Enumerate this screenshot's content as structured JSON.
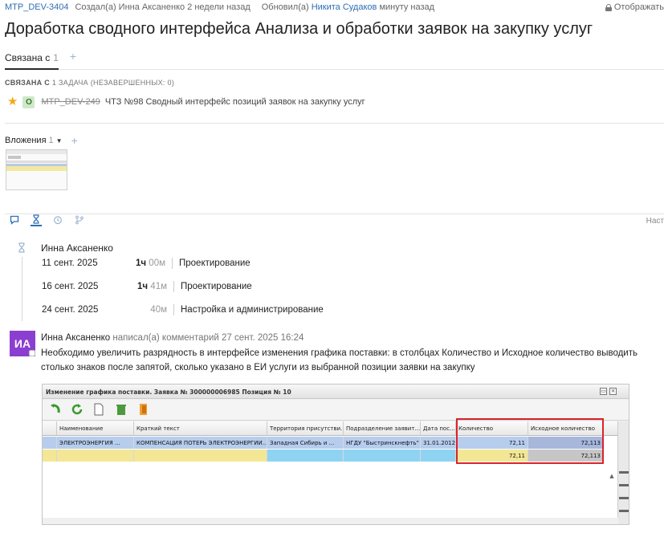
{
  "meta": {
    "issue_key": "MTP_DEV-3404",
    "created": "Создал(а) Инна Аксаненко 2 недели назад",
    "updated_prefix": "Обновил(а)",
    "updated_user": "Никита Судаков",
    "updated_suffix": "минуту назад",
    "right_label": "Отображать"
  },
  "title": "Доработка сводного интерфейса Анализа и обработки заявок на закупку услуг",
  "tabs": [
    {
      "label": "Связана с",
      "count": "1"
    }
  ],
  "linked": {
    "caption": "СВЯЗАНА С",
    "caption_rest": "1 ЗАДАЧА (НЕЗАВЕРШЕННЫХ: 0)",
    "issue": {
      "status": "О",
      "key": "MTP_DEV-249",
      "summary": "ЧТЗ №98 Сводный интерфейс позиций заявок на закупку услуг"
    }
  },
  "attachments": {
    "label": "Вложения",
    "count": "1"
  },
  "activity": {
    "right_label": "Наст"
  },
  "worklog": {
    "user": "Инна Аксаненко",
    "entries": [
      {
        "date": "11 сент. 2025",
        "hours": "1ч",
        "minutes": "00м",
        "activity": "Проектирование"
      },
      {
        "date": "16 сент. 2025",
        "hours": "1ч",
        "minutes": "41м",
        "activity": "Проектирование"
      },
      {
        "date": "24 сент. 2025",
        "hours": "",
        "minutes": "40м",
        "activity": "Настройка и администрирование"
      }
    ]
  },
  "comment": {
    "avatar": "ИА",
    "author": "Инна Аксаненко",
    "action": "написал(а) комментарий 27 сент. 2025 16:24",
    "text": "Необходимо увеличить разрядность в интерфейсе изменения графика поставки: в столбцах Количество и Исходное количество выводить столько знаков после запятой, сколько указано в ЕИ услуги из выбранной позиции заявки на закупку"
  },
  "embedded": {
    "title": "Изменение графика поставки. Заявка № 300000006985 Позиция № 10",
    "headers": [
      "Наименование",
      "Краткий текст",
      "Территория присутстви...",
      "Подразделение заявит...",
      "Дата пос...",
      "Количество",
      "Исходное количество"
    ],
    "row1": [
      "ЭЛЕКТРОЭНЕРГИЯ ...",
      "КОМПЕНСАЦИЯ ПОТЕРЬ ЭЛЕКТРОЭНЕРГИИ...",
      "Западная Сибирь и ...",
      "НГДУ \"Быстринскнефть\"",
      "31.01.2012",
      "72,11",
      "72,113"
    ],
    "row2": [
      "",
      "",
      "",
      "",
      "",
      "72,11",
      "72,113"
    ]
  },
  "colors": {
    "accent": "#2e6eb5",
    "avatar_bg": "#8b3fd0",
    "star": "#f2a91b",
    "highlight_box": "#d9242a"
  },
  "icons": [
    "lock-icon",
    "star-icon",
    "comment-icon",
    "hourglass-icon",
    "history-icon",
    "branch-icon",
    "undo-icon",
    "refresh-icon",
    "document-icon",
    "trash-icon",
    "exit-icon"
  ]
}
